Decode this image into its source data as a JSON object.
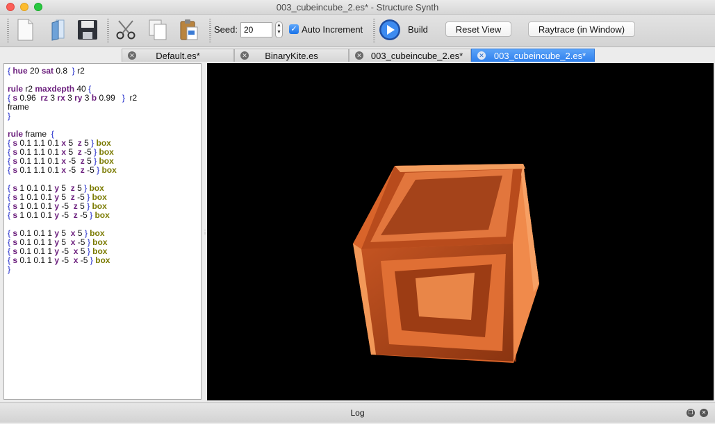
{
  "window": {
    "title": "003_cubeincube_2.es* - Structure Synth"
  },
  "toolbar": {
    "new_icon": "new-document-icon",
    "open_icon": "open-file-icon",
    "save_icon": "save-disk-icon",
    "cut_icon": "scissors-icon",
    "copy_icon": "copy-icon",
    "paste_icon": "paste-clipboard-icon",
    "seed_label": "Seed:",
    "seed_value": "20",
    "auto_increment_label": "Auto Increment",
    "auto_increment_checked": true,
    "build_label": "Build",
    "reset_view_label": "Reset View",
    "raytrace_label": "Raytrace (in Window)"
  },
  "tabs": [
    {
      "label": "Default.es*",
      "active": false
    },
    {
      "label": "BinaryKite.es",
      "active": false
    },
    {
      "label": "003_cubeincube_2.es*",
      "active": false
    },
    {
      "label": "003_cubeincube_2.es*",
      "active": true
    }
  ],
  "editor": {
    "lines": [
      [
        [
          "b",
          "{ "
        ],
        [
          "k",
          "hue"
        ],
        [
          "t",
          " 20 "
        ],
        [
          "k",
          "sat"
        ],
        [
          "t",
          " 0.8  "
        ],
        [
          "b",
          "}"
        ],
        [
          "t",
          " r2"
        ]
      ],
      [],
      [
        [
          "k",
          "rule"
        ],
        [
          "t",
          " r2 "
        ],
        [
          "k",
          "maxdepth"
        ],
        [
          "t",
          " 40 "
        ],
        [
          "b",
          "{"
        ]
      ],
      [
        [
          "b",
          "{ "
        ],
        [
          "k",
          "s"
        ],
        [
          "t",
          " 0.96  "
        ],
        [
          "k",
          "rz"
        ],
        [
          "t",
          " 3 "
        ],
        [
          "k",
          "rx"
        ],
        [
          "t",
          " 3 "
        ],
        [
          "k",
          "ry"
        ],
        [
          "t",
          " 3 "
        ],
        [
          "k",
          "b"
        ],
        [
          "t",
          " 0.99   "
        ],
        [
          "b",
          "}"
        ],
        [
          "t",
          "  r2"
        ]
      ],
      [
        [
          "t",
          "frame"
        ]
      ],
      [
        [
          "b",
          "}"
        ]
      ],
      [],
      [
        [
          "k",
          "rule"
        ],
        [
          "t",
          " frame  "
        ],
        [
          "b",
          "{"
        ]
      ],
      [
        [
          "b",
          "{ "
        ],
        [
          "k",
          "s"
        ],
        [
          "t",
          " 0.1 1.1 0.1 "
        ],
        [
          "k",
          "x"
        ],
        [
          "t",
          " 5  "
        ],
        [
          "k",
          "z"
        ],
        [
          "t",
          " 5 "
        ],
        [
          "b",
          "}"
        ],
        [
          "x",
          " box"
        ]
      ],
      [
        [
          "b",
          "{ "
        ],
        [
          "k",
          "s"
        ],
        [
          "t",
          " 0.1 1.1 0.1 "
        ],
        [
          "k",
          "x"
        ],
        [
          "t",
          " 5  "
        ],
        [
          "k",
          "z"
        ],
        [
          "t",
          " -5 "
        ],
        [
          "b",
          "}"
        ],
        [
          "x",
          " box"
        ]
      ],
      [
        [
          "b",
          "{ "
        ],
        [
          "k",
          "s"
        ],
        [
          "t",
          " 0.1 1.1 0.1 "
        ],
        [
          "k",
          "x"
        ],
        [
          "t",
          " -5  "
        ],
        [
          "k",
          "z"
        ],
        [
          "t",
          " 5 "
        ],
        [
          "b",
          "}"
        ],
        [
          "x",
          " box"
        ]
      ],
      [
        [
          "b",
          "{ "
        ],
        [
          "k",
          "s"
        ],
        [
          "t",
          " 0.1 1.1 0.1 "
        ],
        [
          "k",
          "x"
        ],
        [
          "t",
          " -5  "
        ],
        [
          "k",
          "z"
        ],
        [
          "t",
          " -5 "
        ],
        [
          "b",
          "}"
        ],
        [
          "x",
          " box"
        ]
      ],
      [],
      [
        [
          "b",
          "{ "
        ],
        [
          "k",
          "s"
        ],
        [
          "t",
          " 1 0.1 0.1 "
        ],
        [
          "k",
          "y"
        ],
        [
          "t",
          " 5  "
        ],
        [
          "k",
          "z"
        ],
        [
          "t",
          " 5 "
        ],
        [
          "b",
          "}"
        ],
        [
          "x",
          " box"
        ]
      ],
      [
        [
          "b",
          "{ "
        ],
        [
          "k",
          "s"
        ],
        [
          "t",
          " 1 0.1 0.1 "
        ],
        [
          "k",
          "y"
        ],
        [
          "t",
          " 5  "
        ],
        [
          "k",
          "z"
        ],
        [
          "t",
          " -5 "
        ],
        [
          "b",
          "}"
        ],
        [
          "x",
          " box"
        ]
      ],
      [
        [
          "b",
          "{ "
        ],
        [
          "k",
          "s"
        ],
        [
          "t",
          " 1 0.1 0.1 "
        ],
        [
          "k",
          "y"
        ],
        [
          "t",
          " -5  "
        ],
        [
          "k",
          "z"
        ],
        [
          "t",
          " 5 "
        ],
        [
          "b",
          "}"
        ],
        [
          "x",
          " box"
        ]
      ],
      [
        [
          "b",
          "{ "
        ],
        [
          "k",
          "s"
        ],
        [
          "t",
          " 1 0.1 0.1 "
        ],
        [
          "k",
          "y"
        ],
        [
          "t",
          " -5  "
        ],
        [
          "k",
          "z"
        ],
        [
          "t",
          " -5 "
        ],
        [
          "b",
          "}"
        ],
        [
          "x",
          " box"
        ]
      ],
      [],
      [
        [
          "b",
          "{ "
        ],
        [
          "k",
          "s"
        ],
        [
          "t",
          " 0.1 0.1 1 "
        ],
        [
          "k",
          "y"
        ],
        [
          "t",
          " 5  "
        ],
        [
          "k",
          "x"
        ],
        [
          "t",
          " 5 "
        ],
        [
          "b",
          "}"
        ],
        [
          "x",
          " box"
        ]
      ],
      [
        [
          "b",
          "{ "
        ],
        [
          "k",
          "s"
        ],
        [
          "t",
          " 0.1 0.1 1 "
        ],
        [
          "k",
          "y"
        ],
        [
          "t",
          " 5  "
        ],
        [
          "k",
          "x"
        ],
        [
          "t",
          " -5 "
        ],
        [
          "b",
          "}"
        ],
        [
          "x",
          " box"
        ]
      ],
      [
        [
          "b",
          "{ "
        ],
        [
          "k",
          "s"
        ],
        [
          "t",
          " 0.1 0.1 1 "
        ],
        [
          "k",
          "y"
        ],
        [
          "t",
          " -5  "
        ],
        [
          "k",
          "x"
        ],
        [
          "t",
          " 5 "
        ],
        [
          "b",
          "}"
        ],
        [
          "x",
          " box"
        ]
      ],
      [
        [
          "b",
          "{ "
        ],
        [
          "k",
          "s"
        ],
        [
          "t",
          " 0.1 0.1 1 "
        ],
        [
          "k",
          "y"
        ],
        [
          "t",
          " -5  "
        ],
        [
          "k",
          "x"
        ],
        [
          "t",
          " -5 "
        ],
        [
          "b",
          "}"
        ],
        [
          "x",
          " box"
        ]
      ],
      [
        [
          "b",
          "}"
        ]
      ]
    ]
  },
  "viewport": {
    "background": "#000000",
    "object_color": "#f07a3a"
  },
  "log": {
    "label": "Log",
    "float_icon": "float-dock-icon",
    "close_icon": "close-icon"
  }
}
